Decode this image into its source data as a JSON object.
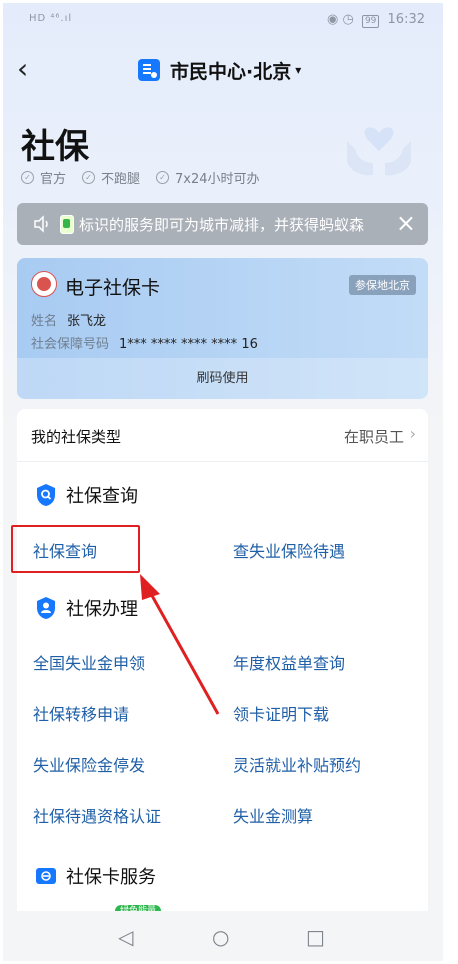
{
  "status_bar": {
    "left_text": "HD ⁴⁶.ıl",
    "battery": "99",
    "time": "16:32"
  },
  "nav": {
    "back_icon": "‹",
    "title": "市民中心·北京",
    "caret": "▾"
  },
  "page": {
    "title": "社保",
    "badges": [
      "官方",
      "不跑腿",
      "7x24小时可办"
    ]
  },
  "notice": {
    "text": "标识的服务即可为城市减排，并获得蚂蚁森",
    "close": "×"
  },
  "card": {
    "title": "电子社保卡",
    "tag": "参保地北京",
    "name_label": "姓名",
    "name_value": "张飞龙",
    "id_label": "社会保障号码",
    "id_value": "1*** **** **** **** 16",
    "footer": "刷码使用"
  },
  "social_type": {
    "label": "我的社保类型",
    "value": "在职员工",
    "chevron": "›"
  },
  "sections": {
    "query": {
      "title": "社保查询",
      "items": [
        "社保查询",
        "查失业保险待遇"
      ]
    },
    "handle": {
      "title": "社保办理",
      "items": [
        "全国失业金申领",
        "年度权益单查询",
        "社保转移申请",
        "领卡证明下载",
        "失业保险金停发",
        "灵活就业补贴预约",
        "社保待遇资格认证",
        "失业金测算"
      ]
    },
    "card_service": {
      "title": "社保卡服务",
      "partial_tag": "绿色能量"
    }
  },
  "bottom_nav": {
    "back": "◁",
    "home": "○",
    "recent": "□"
  },
  "colors": {
    "accent": "#1677ff",
    "link": "#1f5fa7",
    "highlight": "#e02020"
  }
}
